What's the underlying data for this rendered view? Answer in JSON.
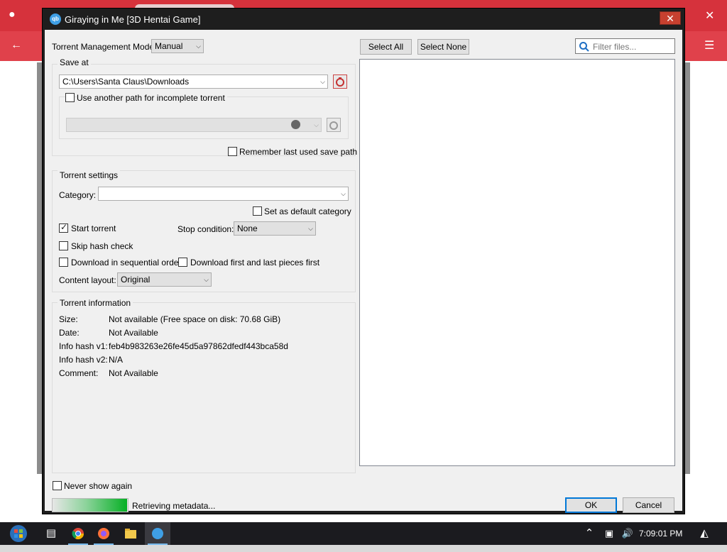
{
  "dialog": {
    "title": "Giraying in Me [3D Hentai Game]",
    "app_icon": "qb",
    "close_label": "✕"
  },
  "torrent_management": {
    "label": "Torrent Management Mode:",
    "value": "Manual"
  },
  "save_at": {
    "group_label": "Save at",
    "path": "C:\\Users\\Santa Claus\\Downloads",
    "incomplete_label": "Use another path for incomplete torrent",
    "incomplete_checked": false,
    "incomplete_path": "",
    "remember_label": "Remember last used save path",
    "remember_checked": false
  },
  "torrent_settings": {
    "group_label": "Torrent settings",
    "category_label": "Category:",
    "category_value": "",
    "default_category_label": "Set as default category",
    "start_torrent_label": "Start torrent",
    "start_torrent_checked": true,
    "stop_condition_label": "Stop condition:",
    "stop_condition_value": "None",
    "skip_hash_label": "Skip hash check",
    "sequential_label": "Download in sequential order",
    "first_last_label": "Download first and last pieces first",
    "content_layout_label": "Content layout:",
    "content_layout_value": "Original"
  },
  "torrent_info": {
    "group_label": "Torrent information",
    "rows": [
      {
        "key": "Size:",
        "value": "Not available (Free space on disk: 70.68 GiB)"
      },
      {
        "key": "Date:",
        "value": "Not Available"
      },
      {
        "key": "Info hash v1:",
        "value": "feb4b983263e26fe45d5a97862dfedf443bca58d"
      },
      {
        "key": "Info hash v2:",
        "value": "N/A"
      },
      {
        "key": "Comment:",
        "value": "Not Available"
      }
    ]
  },
  "files": {
    "select_all": "Select All",
    "select_none": "Select None",
    "filter_placeholder": "Filter files..."
  },
  "footer": {
    "never_show_label": "Never show again",
    "status": "Retrieving metadata...",
    "progress_fraction": 0.45,
    "ok": "OK",
    "cancel": "Cancel"
  },
  "taskbar": {
    "time": "7:09:01 PM",
    "icons": [
      "start-orb-icon",
      "task-view-icon",
      "chrome-icon",
      "firefox-icon",
      "file-explorer-icon",
      "qbittorrent-icon"
    ],
    "tray_icons": [
      "chevron-up-icon",
      "network-icon",
      "volume-icon",
      "notification-icon"
    ]
  },
  "colors": {
    "title_bar": "#1e1e1e",
    "close_button": "#c7402f",
    "browser_red": "#d6323c",
    "progress_green": "#06b025",
    "default_button_border": "#0078d7"
  }
}
